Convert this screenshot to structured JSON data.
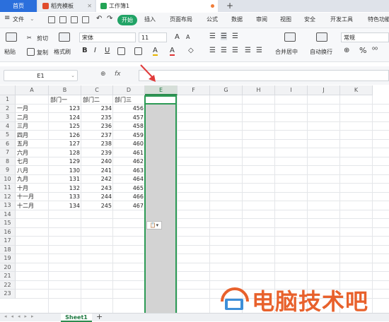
{
  "tabs": {
    "home": "首页",
    "doc": "稻壳模板",
    "book": "工作簿1",
    "new_tab": "+"
  },
  "menu": {
    "file": "文件",
    "start": "开始",
    "items": [
      "插入",
      "页面布局",
      "公式",
      "数据",
      "审阅",
      "视图",
      "安全",
      "开发工具",
      "特色功能"
    ]
  },
  "ribbon": {
    "paste": "粘贴",
    "cut": "剪切",
    "copy": "复制",
    "format_painter": "格式刷",
    "font_name": "宋体",
    "font_size": "11",
    "merge_center": "合并居中",
    "wrap": "自动换行",
    "number_format": "常规",
    "percent": "%"
  },
  "formula_bar": {
    "cell_ref": "E1",
    "fx": "fx"
  },
  "columns": [
    "A",
    "B",
    "C",
    "D",
    "E",
    "F",
    "G",
    "H",
    "I",
    "J",
    "K"
  ],
  "selected_column": "E",
  "rows": [
    "1",
    "2",
    "3",
    "4",
    "5",
    "6",
    "7",
    "8",
    "9",
    "10",
    "11",
    "12",
    "13",
    "14",
    "15",
    "16",
    "17",
    "18",
    "19",
    "20",
    "21",
    "22",
    "23"
  ],
  "table": {
    "headers": [
      "部门一",
      "部门二",
      "部门三"
    ],
    "data": [
      [
        "一月",
        "123",
        "234",
        "456"
      ],
      [
        "二月",
        "124",
        "235",
        "457"
      ],
      [
        "三月",
        "125",
        "236",
        "458"
      ],
      [
        "四月",
        "126",
        "237",
        "459"
      ],
      [
        "五月",
        "127",
        "238",
        "460"
      ],
      [
        "六月",
        "128",
        "239",
        "461"
      ],
      [
        "七月",
        "129",
        "240",
        "462"
      ],
      [
        "八月",
        "130",
        "241",
        "463"
      ],
      [
        "九月",
        "131",
        "242",
        "464"
      ],
      [
        "十月",
        "132",
        "243",
        "465"
      ],
      [
        "十一月",
        "133",
        "244",
        "466"
      ],
      [
        "十二月",
        "134",
        "245",
        "467"
      ]
    ]
  },
  "sheets": {
    "active": "Sheet1",
    "add": "+"
  },
  "watermark": "电脑技术吧",
  "colors": {
    "accent_green": "#21a366",
    "selection_border": "#2c9a55",
    "arrow_red": "#e03a3a",
    "watermark_orange": "#e8612c"
  }
}
